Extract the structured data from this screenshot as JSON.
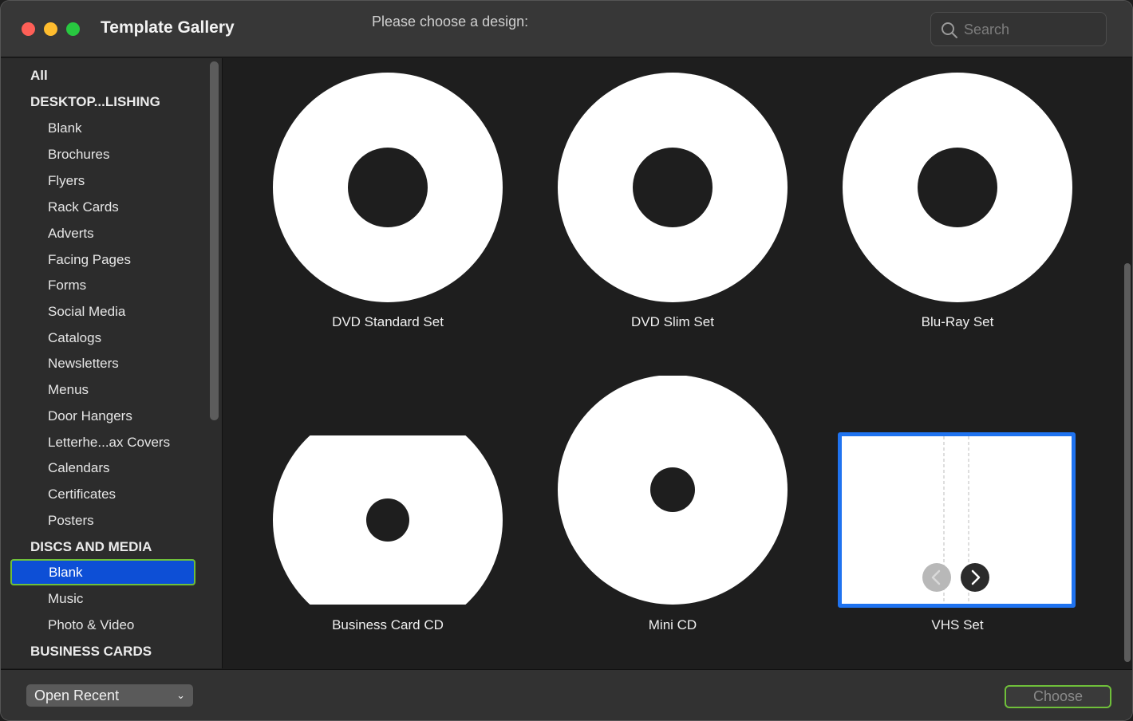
{
  "window": {
    "title": "Template Gallery",
    "subtitle": "Please choose a design:"
  },
  "search": {
    "placeholder": "Search"
  },
  "sidebar": {
    "items": [
      {
        "label": "All",
        "kind": "header"
      },
      {
        "label": "DESKTOP...LISHING",
        "kind": "header"
      },
      {
        "label": "Blank",
        "kind": "child"
      },
      {
        "label": "Brochures",
        "kind": "child"
      },
      {
        "label": "Flyers",
        "kind": "child"
      },
      {
        "label": "Rack Cards",
        "kind": "child"
      },
      {
        "label": "Adverts",
        "kind": "child"
      },
      {
        "label": "Facing Pages",
        "kind": "child"
      },
      {
        "label": "Forms",
        "kind": "child"
      },
      {
        "label": "Social Media",
        "kind": "child"
      },
      {
        "label": "Catalogs",
        "kind": "child"
      },
      {
        "label": "Newsletters",
        "kind": "child"
      },
      {
        "label": "Menus",
        "kind": "child"
      },
      {
        "label": "Door Hangers",
        "kind": "child"
      },
      {
        "label": "Letterhe...ax Covers",
        "kind": "child"
      },
      {
        "label": "Calendars",
        "kind": "child"
      },
      {
        "label": "Certificates",
        "kind": "child"
      },
      {
        "label": "Posters",
        "kind": "child"
      },
      {
        "label": "DISCS AND MEDIA",
        "kind": "header"
      },
      {
        "label": "Blank",
        "kind": "child",
        "selected": true
      },
      {
        "label": "Music",
        "kind": "child"
      },
      {
        "label": "Photo & Video",
        "kind": "child"
      },
      {
        "label": "BUSINESS CARDS",
        "kind": "header"
      }
    ]
  },
  "templates": [
    {
      "label": "DVD Standard Set",
      "icon": "disc-icon"
    },
    {
      "label": "DVD Slim Set",
      "icon": "disc-icon"
    },
    {
      "label": "Blu-Ray Set",
      "icon": "disc-icon"
    },
    {
      "label": "Business Card CD",
      "icon": "business-card-disc-icon"
    },
    {
      "label": "Mini CD",
      "icon": "mini-disc-icon"
    },
    {
      "label": "VHS Set",
      "icon": "vhs-cover-icon",
      "selected": true
    }
  ],
  "footer": {
    "open_recent_label": "Open Recent",
    "choose_label": "Choose"
  },
  "colors": {
    "selection_blue": "#0d4fd6",
    "focus_green": "#6fbf3a",
    "tile_highlight": "#1f73f0"
  }
}
